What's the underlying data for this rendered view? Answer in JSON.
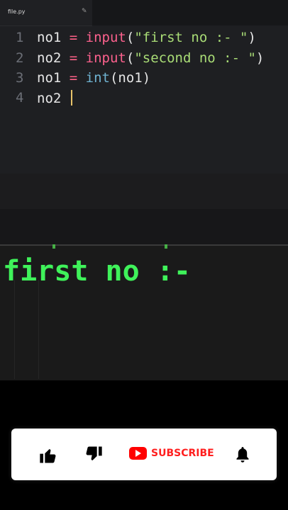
{
  "editor": {
    "tab": {
      "filename": "file.py",
      "close_glyph": "✎"
    },
    "lines": [
      {
        "number": "1",
        "tokens": [
          {
            "t": "no1",
            "c": "id"
          },
          {
            "t": " = ",
            "c": "op"
          },
          {
            "t": "input",
            "c": "fn"
          },
          {
            "t": "(",
            "c": "id"
          },
          {
            "t": "\"first no :- \"",
            "c": "str"
          },
          {
            "t": ")",
            "c": "id"
          }
        ]
      },
      {
        "number": "2",
        "tokens": [
          {
            "t": "no2",
            "c": "id"
          },
          {
            "t": " = ",
            "c": "op"
          },
          {
            "t": "input",
            "c": "fn"
          },
          {
            "t": "(",
            "c": "id"
          },
          {
            "t": "\"second no :- \"",
            "c": "str"
          },
          {
            "t": ")",
            "c": "id"
          }
        ]
      },
      {
        "number": "3",
        "tokens": [
          {
            "t": "no1",
            "c": "id"
          },
          {
            "t": " = ",
            "c": "op"
          },
          {
            "t": "int",
            "c": "fn2"
          },
          {
            "t": "(no1)",
            "c": "id"
          }
        ]
      },
      {
        "number": "4",
        "tokens": [
          {
            "t": "no2",
            "c": "id"
          }
        ],
        "cursor": true
      }
    ]
  },
  "terminal": {
    "prompt_text": "first no :-"
  },
  "subscribe_bar": {
    "like_icon": "thumbs-up-icon",
    "dislike_icon": "thumbs-down-icon",
    "youtube_icon": "youtube-logo-icon",
    "subscribe_label": "SUBSCRIBE",
    "bell_icon": "bell-icon",
    "colors": {
      "subscribe": "#ff1e1e",
      "logo": "#ff0000",
      "bar": "#ffffff"
    }
  },
  "colors": {
    "editor_bg": "#1e1f22",
    "keyword_pink": "#fc618d",
    "builtin_blue": "#6fb3d2",
    "string_green": "#a9dc76",
    "terminal_text": "#3ff25a"
  }
}
